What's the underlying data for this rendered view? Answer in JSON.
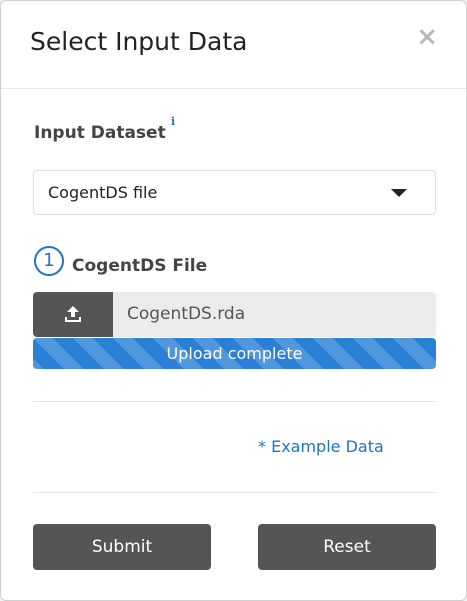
{
  "modal": {
    "title": "Select Input Data",
    "close_symbol": "×"
  },
  "input_dataset": {
    "label": "Input Dataset",
    "info_symbol": "i",
    "selected": "CogentDS file"
  },
  "file_step": {
    "step_number": "1",
    "label": "CogentDS File",
    "upload_icon": "upload-icon",
    "file_name": "CogentDS.rda",
    "progress_text": "Upload complete",
    "progress_fraction": 1.0,
    "progress_color": "#2a80d6"
  },
  "example_link": "* Example Data",
  "actions": {
    "submit_label": "Submit",
    "reset_label": "Reset"
  }
}
